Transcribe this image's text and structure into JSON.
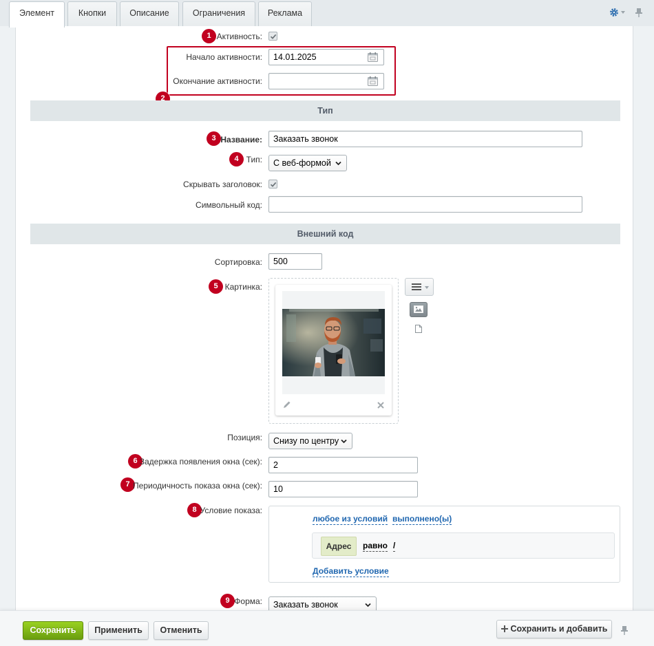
{
  "tabs": [
    {
      "label": "Элемент",
      "active": true
    },
    {
      "label": "Кнопки",
      "active": false
    },
    {
      "label": "Описание",
      "active": false
    },
    {
      "label": "Ограничения",
      "active": false
    },
    {
      "label": "Реклама",
      "active": false
    }
  ],
  "badges": [
    "1",
    "2",
    "3",
    "4",
    "5",
    "6",
    "7",
    "8",
    "9"
  ],
  "colors": {
    "badge": "#c1001f",
    "link": "#2067b0",
    "save_button": "#7bb215",
    "section": "#e0e6e8"
  },
  "activity": {
    "active_label": "Активность:",
    "active_checked": true,
    "start_label": "Начало активности:",
    "start_value": "14.01.2025",
    "end_label": "Окончание активности:",
    "end_value": ""
  },
  "section_type": {
    "title": "Тип"
  },
  "name": {
    "label": "Название:",
    "value": "Заказать звонок"
  },
  "type": {
    "label": "Тип:",
    "selected": "С веб-формой"
  },
  "hide_title": {
    "label": "Скрывать заголовок:",
    "checked": true
  },
  "symbolic_code": {
    "label": "Символьный код:",
    "value": ""
  },
  "section_external": {
    "title": "Внешний код"
  },
  "sort": {
    "label": "Сортировка:",
    "value": "500"
  },
  "picture": {
    "label": "Картинка:"
  },
  "position": {
    "label": "Позиция:",
    "selected": "Снизу по центру"
  },
  "delay": {
    "label": "Задержка появления окна (сек):",
    "value": "2"
  },
  "period": {
    "label": "Периодичность показа окна (сек):",
    "value": "10"
  },
  "condition": {
    "label": "Условие показа:",
    "any_link": "любое из условий",
    "fulfilled_link": "выполнено(ы)",
    "field": "Адрес",
    "operator": "равно",
    "value": "/",
    "add_link": "Добавить условие"
  },
  "form": {
    "label": "Форма:",
    "selected": "Заказать звонок"
  },
  "footer": {
    "save": "Сохранить",
    "apply": "Применить",
    "cancel": "Отменить",
    "save_add": "Сохранить и добавить"
  }
}
